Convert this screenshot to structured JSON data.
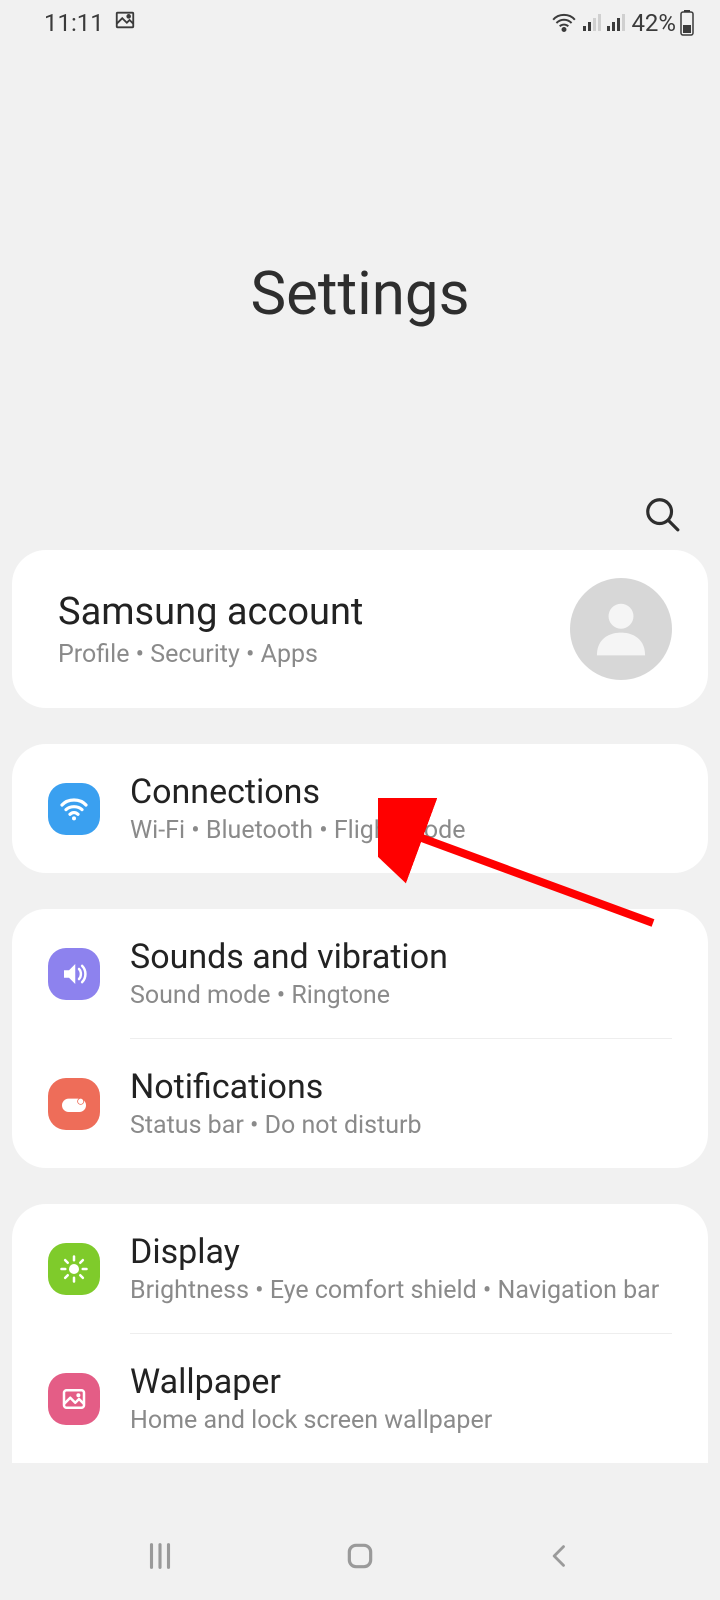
{
  "status": {
    "time": "11:11",
    "battery_pct": "42%"
  },
  "hero": {
    "title": "Settings"
  },
  "account": {
    "title": "Samsung account",
    "sub": "Profile  •  Security  •  Apps"
  },
  "groups": [
    {
      "items": [
        {
          "key": "connections",
          "title": "Connections",
          "sub": "Wi-Fi  •  Bluetooth  •  Flight mode",
          "icon": "wifi",
          "color": "blue"
        }
      ]
    },
    {
      "items": [
        {
          "key": "sounds",
          "title": "Sounds and vibration",
          "sub": "Sound mode  •  Ringtone",
          "icon": "volume",
          "color": "purple"
        },
        {
          "key": "notifications",
          "title": "Notifications",
          "sub": "Status bar  •  Do not disturb",
          "icon": "notify",
          "color": "orange"
        }
      ]
    },
    {
      "items": [
        {
          "key": "display",
          "title": "Display",
          "sub": "Brightness  •  Eye comfort shield  •  Navigation bar",
          "icon": "sun",
          "color": "green"
        },
        {
          "key": "wallpaper",
          "title": "Wallpaper",
          "sub": "Home and lock screen wallpaper",
          "icon": "image",
          "color": "pink"
        }
      ]
    }
  ]
}
